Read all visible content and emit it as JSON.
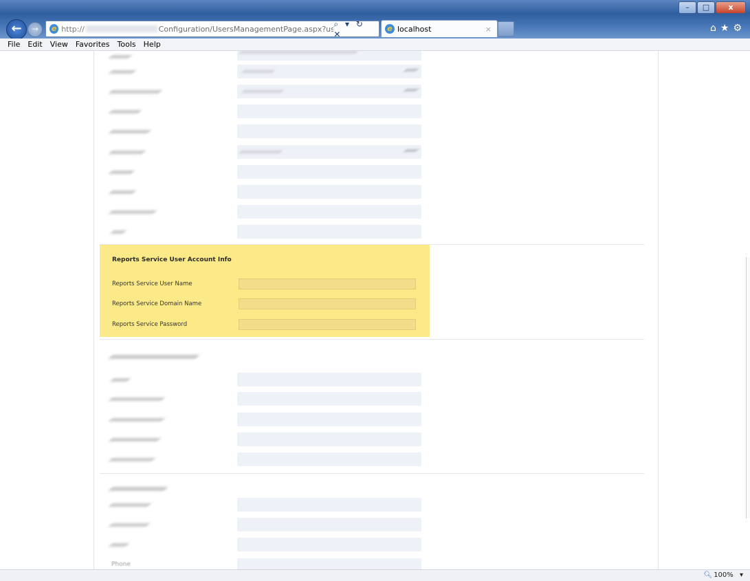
{
  "browser": {
    "url_scheme": "http://",
    "url_path": "Configuration/UsersManagementPage.aspx?username=t",
    "tab_title": "localhost",
    "tab_close": "×",
    "address_tools": "⌕ ▾ ↻ ✕",
    "right_icons": "⌂★⚙",
    "window_controls": [
      "–",
      "□",
      "x"
    ]
  },
  "menu": [
    "File",
    "Edit",
    "View",
    "Favorites",
    "Tools",
    "Help"
  ],
  "reports_section": {
    "title": "Reports Service User Account Info",
    "fields": [
      {
        "label": "Reports Service User Name",
        "value": ""
      },
      {
        "label": "Reports Service Domain Name",
        "value": ""
      },
      {
        "label": "Reports Service Password",
        "value": ""
      }
    ],
    "highlight_color": "#fce987"
  },
  "partial_label": "Phone",
  "status": {
    "zoom": "100%",
    "zoom_caret": "▾"
  }
}
